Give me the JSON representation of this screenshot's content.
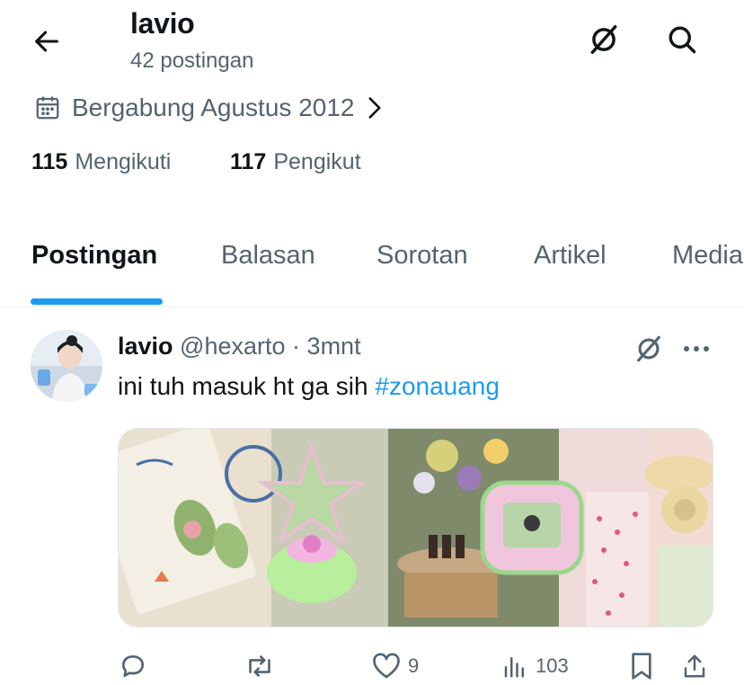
{
  "header": {
    "title": "lavio",
    "subtitle": "42 postingan",
    "back_icon": "arrow-left-icon",
    "grok_icon": "grok-icon",
    "search_icon": "search-icon"
  },
  "profile": {
    "joined_text": "Bergabung Agustus 2012",
    "following_count": "115",
    "following_label": "Mengikuti",
    "followers_count": "117",
    "followers_label": "Pengikut"
  },
  "tabs": [
    {
      "label": "Postingan",
      "active": true
    },
    {
      "label": "Balasan",
      "active": false
    },
    {
      "label": "Sorotan",
      "active": false
    },
    {
      "label": "Artikel",
      "active": false
    },
    {
      "label": "Media",
      "active": false
    }
  ],
  "post": {
    "display_name": "lavio",
    "handle": "@hexarto",
    "separator": "·",
    "time": "3mnt",
    "text": "ini tuh masuk ht ga sih ",
    "hashtag": "#zonauang",
    "actions": {
      "reply_count": "",
      "repost_count": "",
      "like_count": "9",
      "view_count": "103"
    }
  },
  "colors": {
    "accent": "#1d9bf0",
    "text_primary": "#0f1419",
    "text_secondary": "#536471",
    "divider": "#eff3f4"
  }
}
